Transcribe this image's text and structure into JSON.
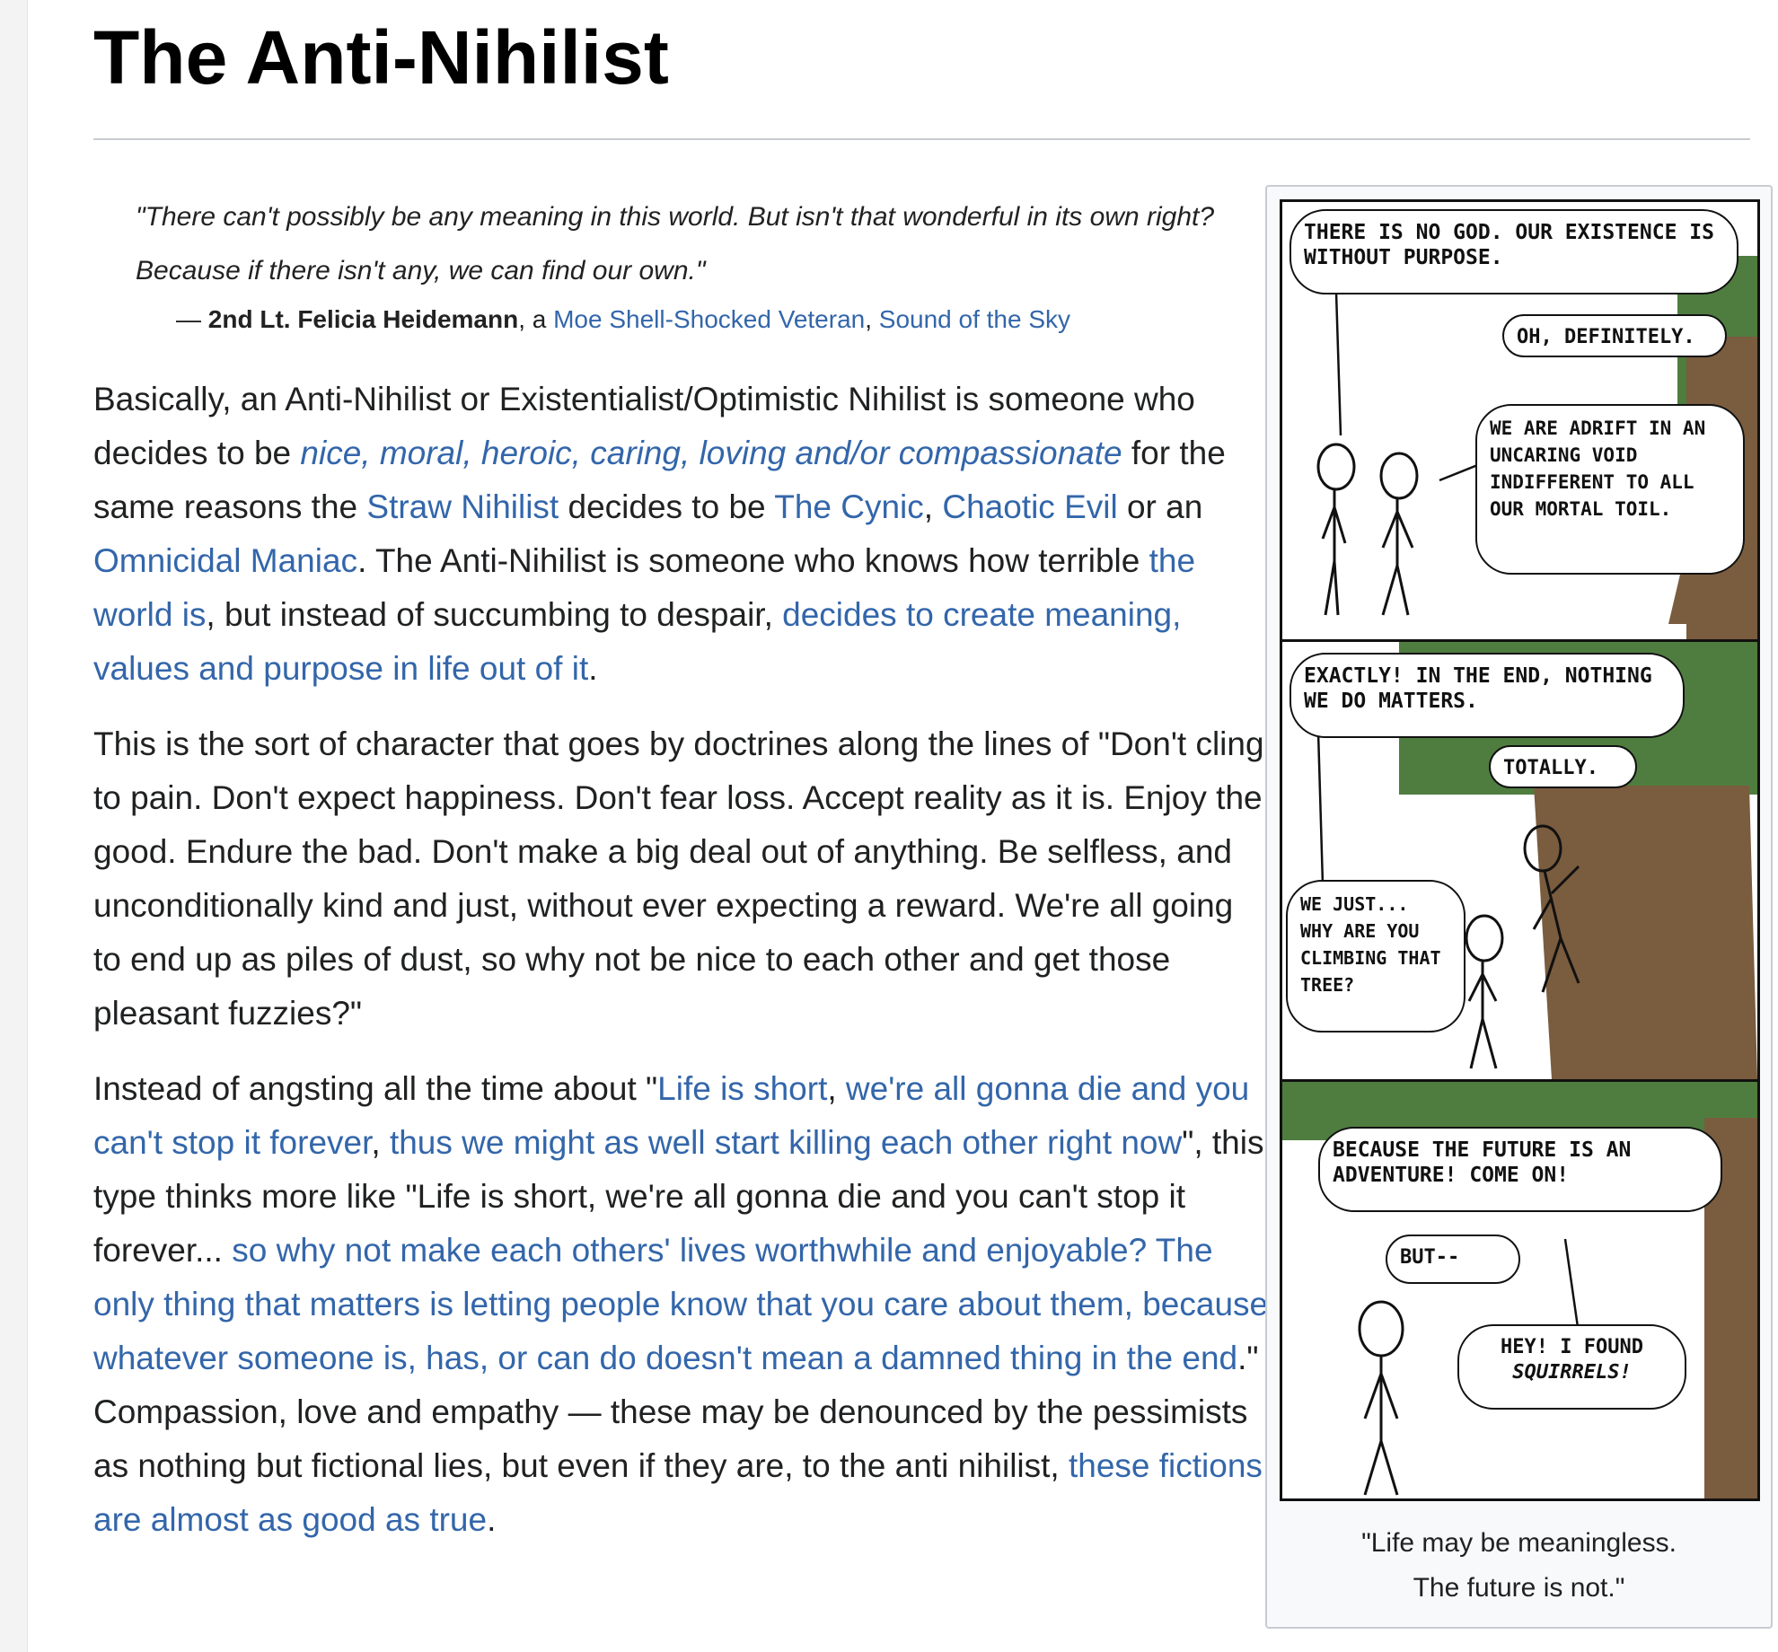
{
  "page": {
    "title": "The Anti-Nihilist"
  },
  "quote": {
    "text": "\"There can't possibly be any meaning in this world. But isn't that wonderful in its own right? Because if there isn't any, we can find our own.\"",
    "dash": "— ",
    "speaker": "2nd Lt. Felicia Heidemann",
    "sep1": ", a ",
    "trope_link": "Moe Shell-Shocked Veteran",
    "sep2": ", ",
    "work_link": "Sound of the Sky"
  },
  "paragraphs": {
    "p1": {
      "t1": "Basically, an Anti-Nihilist or Existentialist/Optimistic Nihilist is someone who decides to be ",
      "l1": "nice, moral, heroic, caring, loving and/or compassionate",
      "t2": " for the same reasons the ",
      "l2": "Straw Nihilist",
      "t3": " decides to be ",
      "l3": "The Cynic",
      "t4": ", ",
      "l4": "Chaotic Evil",
      "t5": " or an ",
      "l5": "Omnicidal Maniac",
      "t6": ". The Anti-Nihilist is someone who knows how terrible ",
      "l6": "the world is",
      "t7": ", but instead of succumbing to despair, ",
      "l7": "decides to create meaning, values and purpose in life out of it",
      "t8": "."
    },
    "p2": {
      "text": "This is the sort of character that goes by doctrines along the lines of \"Don't cling to pain. Don't expect happiness. Don't fear loss. Accept reality as it is. Enjoy the good. Endure the bad. Don't make a big deal out of anything. Be selfless, and unconditionally kind and just, without ever expecting a reward. We're all going to end up as piles of dust, so why not be nice to each other and get those pleasant fuzzies?\""
    },
    "p3": {
      "t1": "Instead of angsting all the time about \"",
      "l1": "Life is short",
      "t2": ", ",
      "l2": "we're all gonna die and you can't stop it forever",
      "t3": ", ",
      "l3": "thus we might as well start killing each other right now",
      "t4": "\", this type thinks more like \"Life is short, we're all gonna die and you can't stop it forever... ",
      "l4": "so why not make each others' lives worthwhile and enjoyable? The only thing that matters is letting people know that you care about them, because whatever someone is, has, or can do doesn't mean a damned thing in the end",
      "t5": ".\" Compassion, love and empathy — these may be denounced by the pessimists as nothing but fictional lies, but even if they are, to the anti nihilist, ",
      "l5": "these fictions are almost as good as true",
      "t6": "."
    }
  },
  "comic": {
    "panel1": {
      "b1": "THERE IS NO GOD. OUR EXISTENCE IS WITHOUT PURPOSE.",
      "b2": "OH, DEFINITELY.",
      "b3": "WE ARE ADRIFT IN AN UNCARING VOID INDIFFERENT TO ALL OUR MORTAL TOIL."
    },
    "panel2": {
      "b1": "EXACTLY! IN THE END, NOTHING WE DO MATTERS.",
      "b2": "TOTALLY.",
      "b3": "WE JUST... WHY ARE YOU CLIMBING THAT TREE?"
    },
    "panel3": {
      "b1": "BECAUSE THE FUTURE IS AN ADVENTURE! COME ON!",
      "b2": "BUT--",
      "b3_line1": "HEY! I FOUND",
      "b3_line2": "SQUIRRELS!"
    },
    "caption_line1": "\"Life may be meaningless.",
    "caption_line2": "The future is not.\"",
    "colors": {
      "tree_canopy": "#4f7d3f",
      "tree_trunk": "#7a5c3e",
      "ink": "#111111"
    }
  },
  "colors": {
    "link": "#3366aa",
    "text": "#202122"
  }
}
